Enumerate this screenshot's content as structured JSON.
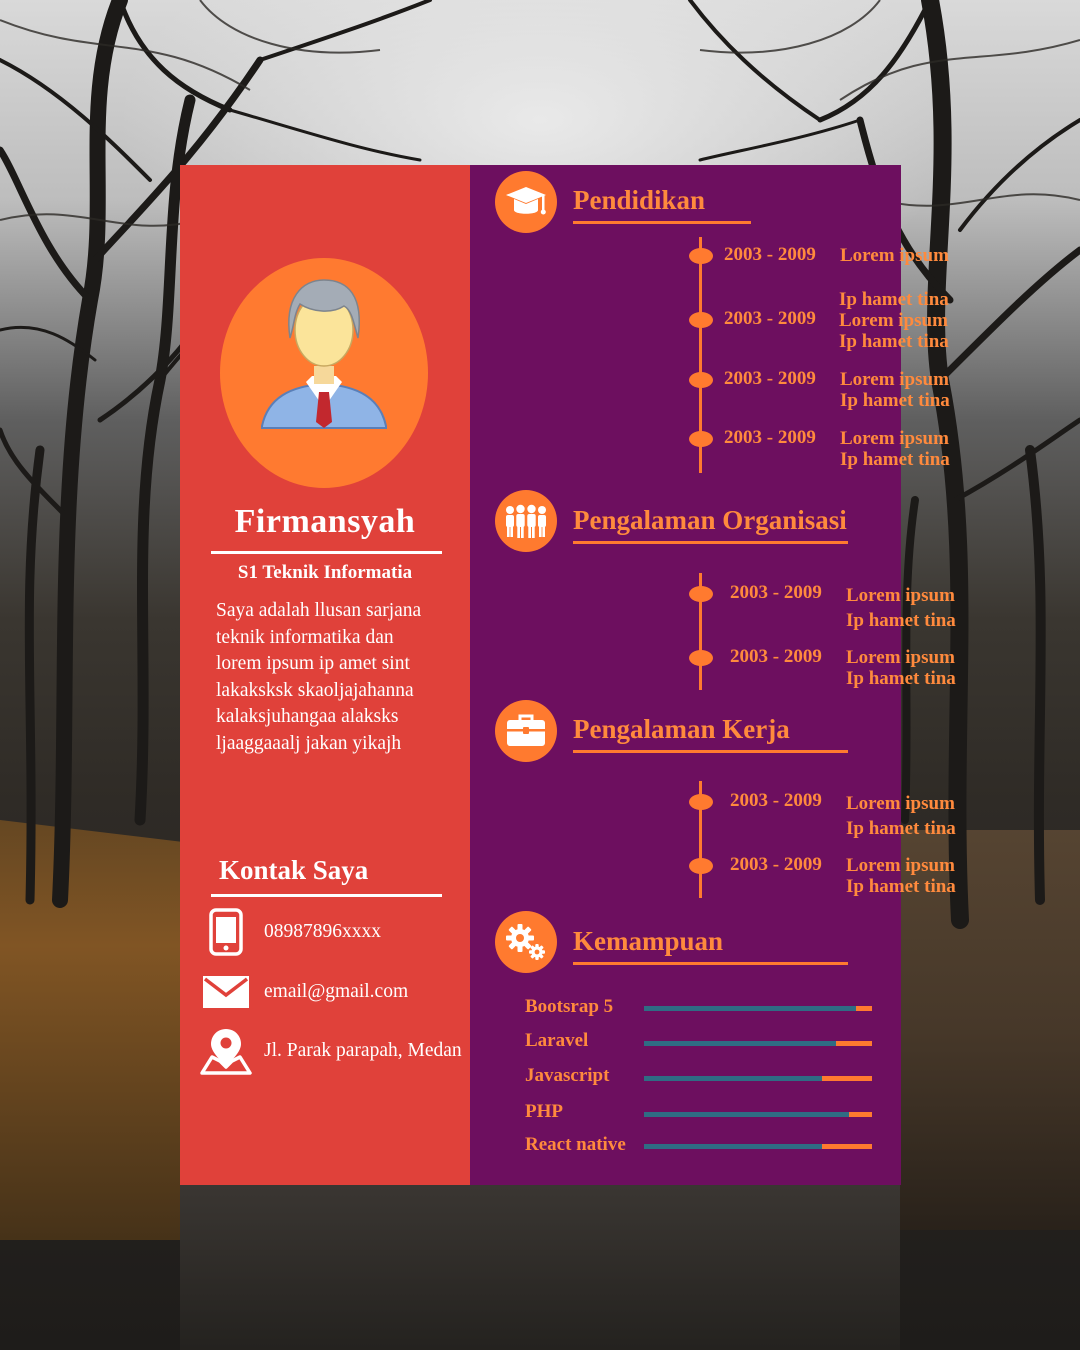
{
  "profile": {
    "name": "Firmansyah",
    "degree": "S1 Teknik Informatia",
    "about": [
      "Saya adalah llusan sarjana",
      "teknik informatika dan",
      "lorem ipsum ip amet sint",
      "lakaksksk skaoljajahanna",
      "kalaksjuhangaa alaksks",
      "ljaaggaaalj jakan yikajh"
    ]
  },
  "contact": {
    "title": "Kontak Saya",
    "phone": "08987896xxxx",
    "email": "email@gmail.com",
    "address": "Jl. Parak parapah, Medan"
  },
  "education": {
    "title": "Pendidikan",
    "items": [
      {
        "year": "2003 - 2009",
        "lines": [
          "Lorem ipsum"
        ]
      },
      {
        "year": "2003 - 2009",
        "lines": [
          "Ip hamet tina",
          "Lorem ipsum",
          "Ip hamet tina"
        ]
      },
      {
        "year": "2003 - 2009",
        "lines": [
          "Lorem ipsum",
          "Ip hamet tina"
        ]
      },
      {
        "year": "2003 - 2009",
        "lines": [
          "Lorem ipsum",
          "Ip hamet tina"
        ]
      }
    ]
  },
  "organization": {
    "title": "Pengalaman Organisasi",
    "items": [
      {
        "year": "2003 - 2009",
        "lines": [
          "Lorem ipsum",
          "Ip hamet tina"
        ]
      },
      {
        "year": "2003 - 2009",
        "lines": [
          "Lorem ipsum",
          "Ip hamet tina"
        ]
      }
    ]
  },
  "work": {
    "title": "Pengalaman Kerja",
    "items": [
      {
        "year": "2003 - 2009",
        "lines": [
          "Lorem ipsum",
          "Ip hamet tina"
        ]
      },
      {
        "year": "2003 - 2009",
        "lines": [
          "Lorem ipsum",
          "Ip hamet tina"
        ]
      }
    ]
  },
  "skills": {
    "title": "Kemampuan",
    "items": [
      {
        "name": "Bootsrap 5",
        "level": 0.93
      },
      {
        "name": "Laravel",
        "level": 0.84
      },
      {
        "name": "Javascript",
        "level": 0.78
      },
      {
        "name": "PHP",
        "level": 0.9
      },
      {
        "name": "React native",
        "level": 0.78
      }
    ]
  },
  "colors": {
    "left_panel": "#e0413a",
    "right_panel": "#6d0f5f",
    "accent": "#ff7a2f",
    "skill_fill": "#2f6c84"
  },
  "icons": [
    "graduation-cap-icon",
    "group-icon",
    "briefcase-icon",
    "gears-icon",
    "phone-icon",
    "mail-icon",
    "map-pin-icon"
  ]
}
